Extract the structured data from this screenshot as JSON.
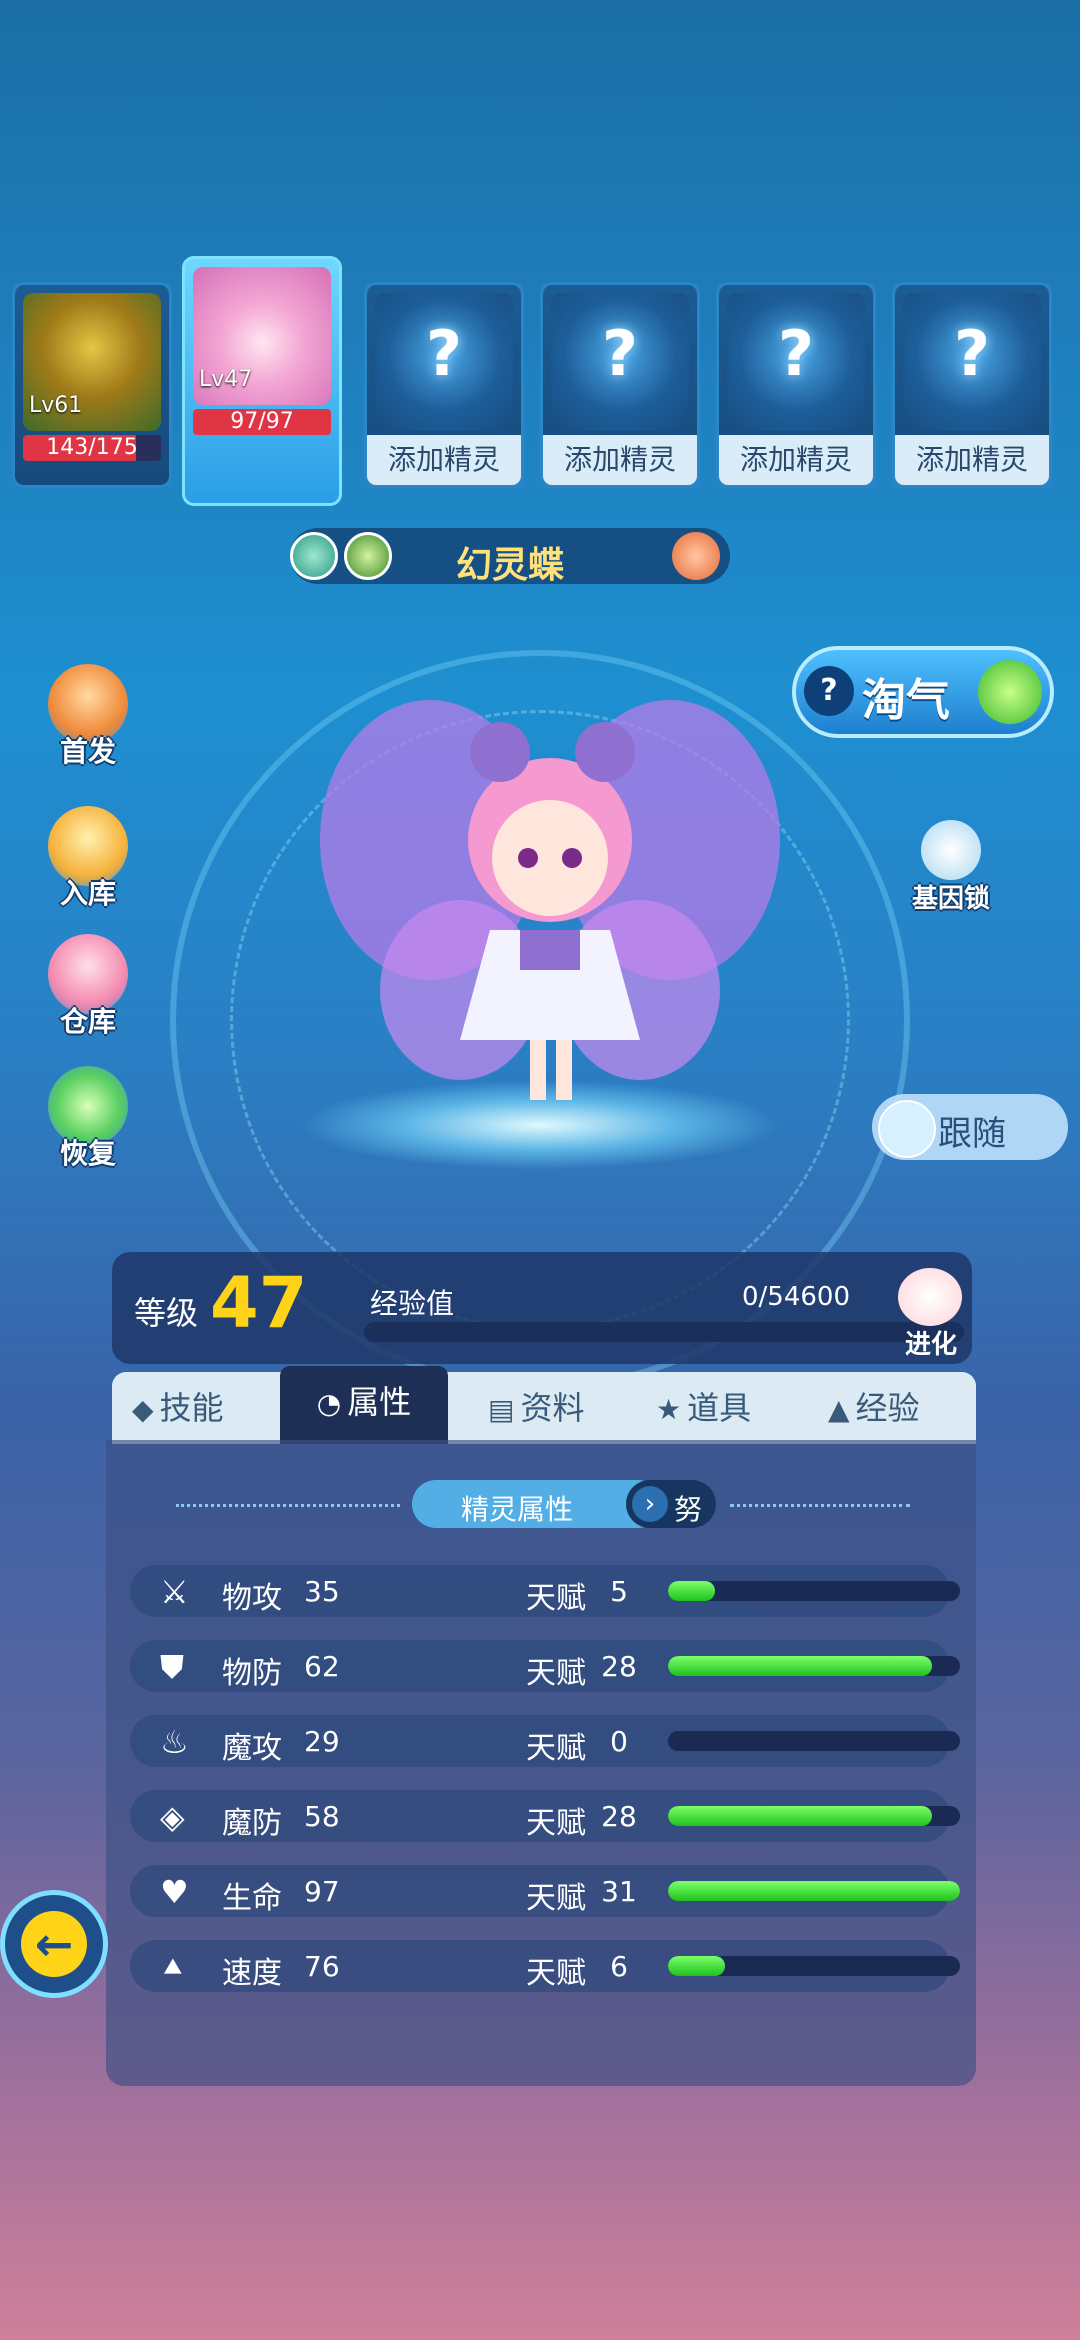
{
  "team": {
    "slots": [
      {
        "level": "Lv61",
        "hp": "143/175",
        "hp_ratio": 0.817
      },
      {
        "level": "Lv47",
        "hp": "97/97",
        "hp_ratio": 1.0
      },
      {
        "placeholder": "?",
        "label": "添加精灵"
      },
      {
        "placeholder": "?",
        "label": "添加精灵"
      },
      {
        "placeholder": "?",
        "label": "添加精灵"
      },
      {
        "placeholder": "?",
        "label": "添加精灵"
      }
    ]
  },
  "pet": {
    "name": "幻灵蝶"
  },
  "left_menu": [
    "首发",
    "入库",
    "仓库",
    "恢复"
  ],
  "right": {
    "naughty_help": "?",
    "naughty": "淘气",
    "gene_lock": "基因锁",
    "follow": "跟随"
  },
  "level": {
    "label": "等级",
    "value": "47",
    "exp_label": "经验值",
    "exp_value": "0/54600",
    "evolve": "进化"
  },
  "tabs": [
    {
      "label": "技能",
      "icon": "chevron-up-icon"
    },
    {
      "label": "属性",
      "icon": "attributes-icon",
      "active": true
    },
    {
      "label": "资料",
      "icon": "clipboard-icon"
    },
    {
      "label": "道具",
      "icon": "item-icon"
    },
    {
      "label": "经验",
      "icon": "flask-icon"
    }
  ],
  "attributes": {
    "header": "精灵属性",
    "effort": "努",
    "talent_label": "天赋",
    "talent_max": 31,
    "stats": [
      {
        "name": "物攻",
        "value": "35",
        "talent": "5",
        "icon": "sword-icon"
      },
      {
        "name": "物防",
        "value": "62",
        "talent": "28",
        "icon": "shield-icon"
      },
      {
        "name": "魔攻",
        "value": "29",
        "talent": "0",
        "icon": "flame-icon"
      },
      {
        "name": "魔防",
        "value": "58",
        "talent": "28",
        "icon": "magic-shield-icon"
      },
      {
        "name": "生命",
        "value": "97",
        "talent": "31",
        "icon": "heart-icon"
      },
      {
        "name": "速度",
        "value": "76",
        "talent": "6",
        "icon": "boot-icon"
      }
    ]
  },
  "colors": {
    "level_number": "#ffd318",
    "talent_fill": "#1ec21e",
    "hp_fill": "#e03545",
    "name": "#ffe17a"
  }
}
